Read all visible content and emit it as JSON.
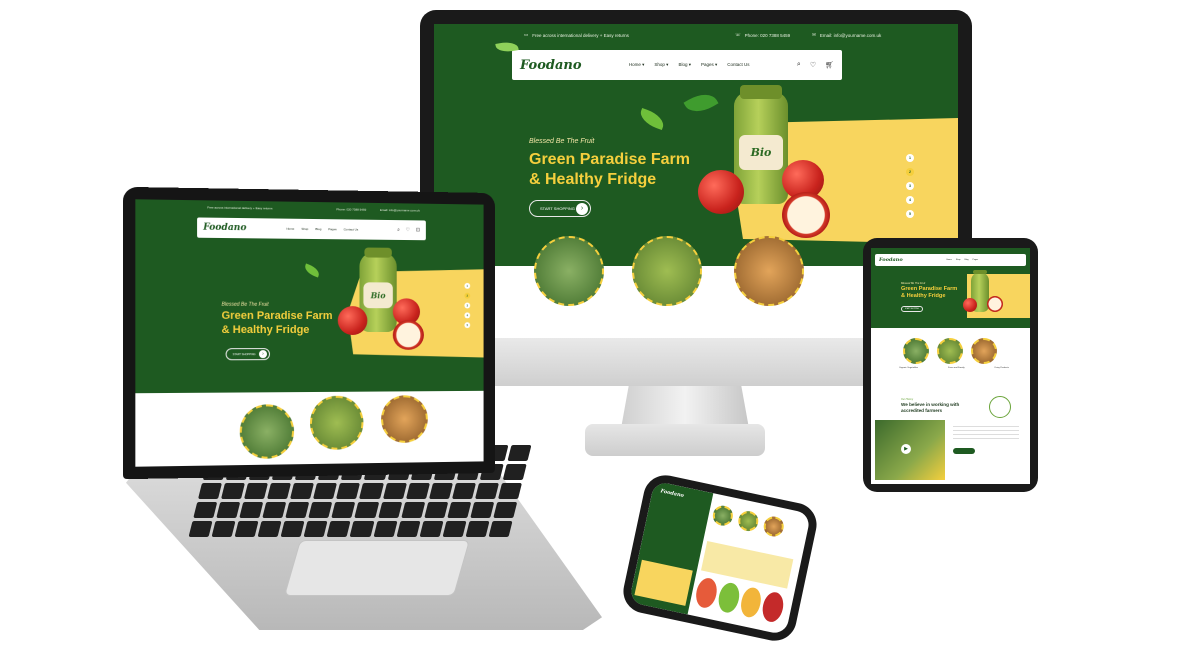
{
  "site": {
    "brand": "Foodano",
    "topbar": {
      "promo": "Free across international delivery + Easy returns",
      "phone": "Phone: 020 7388 5459",
      "email": "Email: info@yourname.com.uk"
    },
    "nav": [
      {
        "label": "Home",
        "caret": true
      },
      {
        "label": "Shop",
        "caret": true
      },
      {
        "label": "Blog",
        "caret": true
      },
      {
        "label": "Pages",
        "caret": true
      },
      {
        "label": "Contact Us",
        "caret": false
      }
    ],
    "cart_count": "0",
    "hero": {
      "kicker": "Blessed Be The Fruit",
      "headline_line1": "Green Paradise Farm",
      "headline_line2": "& Healthy Fridge",
      "button": "START SHOPPING",
      "slides": [
        "1",
        "2",
        "3",
        "4",
        "5"
      ],
      "active_slide": 2,
      "jar_label": "Bio"
    },
    "categories": [
      "Organic Vegetables",
      "Farm and Family",
      "Dairy Products"
    ],
    "about": {
      "kicker": "Our History",
      "title_line1": "We believe in working with",
      "title_line2": "accredited farmers"
    }
  },
  "colors": {
    "brand_green": "#1e5a21",
    "accent_yellow": "#f5cf3d",
    "hero_yellow": "#f8d55e"
  },
  "icons": [
    "truck-icon",
    "phone-icon",
    "mail-icon",
    "search-icon",
    "heart-icon",
    "cart-icon",
    "arrow-right-icon",
    "leaf-icon"
  ]
}
